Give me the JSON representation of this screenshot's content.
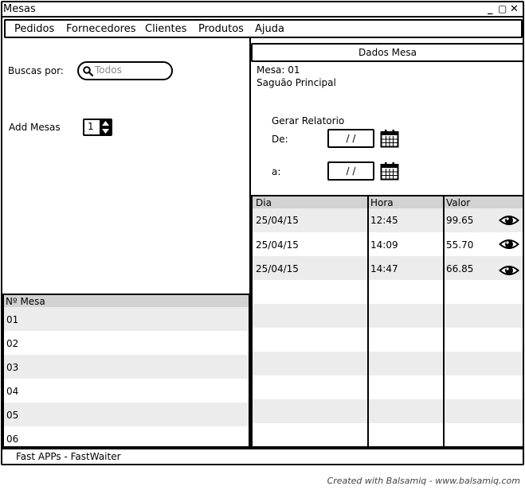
{
  "window": {
    "title": "Mesas",
    "minimize": "_",
    "maximize": "▢",
    "close": "✕"
  },
  "menu": [
    "Pedidos",
    "Fornecedores",
    "Clientes",
    "Produtos",
    "Ajuda"
  ],
  "search": {
    "label": "Buscas por:",
    "placeholder": "Todos"
  },
  "add": {
    "label": "Add Mesas",
    "value": "1"
  },
  "mesa_table": {
    "header": "Nº Mesa",
    "rows": [
      "01",
      "02",
      "03",
      "04",
      "05",
      "06"
    ]
  },
  "panel": {
    "title": "Dados Mesa",
    "mesa": "Mesa: 01",
    "local": "Saguão Principal",
    "report_title": "Gerar Relatorio",
    "from_label": "De:",
    "to_label": "a:",
    "from_value": "/ /",
    "to_value": "/ /"
  },
  "orders": {
    "headers": [
      "Dia",
      "Hora",
      "Valor"
    ],
    "rows": [
      {
        "dia": "25/04/15",
        "hora": "12:45",
        "valor": "99.65"
      },
      {
        "dia": "25/04/15",
        "hora": "14:09",
        "valor": "55.70"
      },
      {
        "dia": "25/04/15",
        "hora": "14:47",
        "valor": "66.85"
      }
    ]
  },
  "status": "Fast APPs - FastWaiter",
  "footer": "Created with Balsamiq - www.balsamiq.com",
  "icons": {
    "search": "search-icon",
    "calendar": "calendar-icon",
    "view": "eye-icon"
  }
}
